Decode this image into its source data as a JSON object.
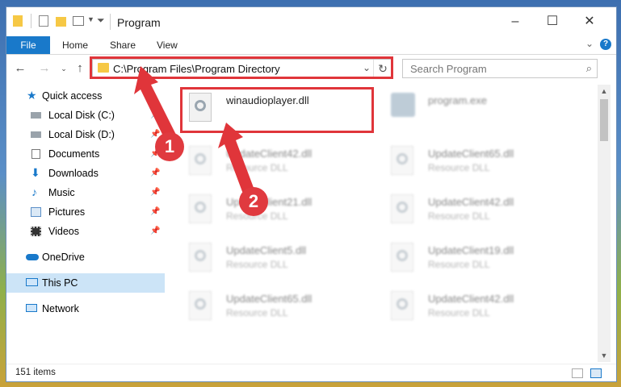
{
  "window": {
    "title": "Program"
  },
  "ribbon": {
    "file_tab": "File",
    "home_tab": "Home",
    "share_tab": "Share",
    "view_tab": "View"
  },
  "address": {
    "path": "C:\\Program Files\\Program Directory"
  },
  "search": {
    "placeholder": "Search Program"
  },
  "sidebar": {
    "items": [
      {
        "label": "Quick access"
      },
      {
        "label": "Local Disk (C:)"
      },
      {
        "label": "Local Disk (D:)"
      },
      {
        "label": "Documents"
      },
      {
        "label": "Downloads"
      },
      {
        "label": "Music"
      },
      {
        "label": "Pictures"
      },
      {
        "label": "Videos"
      },
      {
        "label": "OneDrive"
      },
      {
        "label": "This PC"
      },
      {
        "label": "Network"
      }
    ]
  },
  "files": [
    {
      "name": "winaudioplayer.dll",
      "type": ""
    },
    {
      "name": "program.exe",
      "type": ""
    },
    {
      "name": "UpdateClient42.dll",
      "type": "Resource DLL"
    },
    {
      "name": "UpdateClient65.dll",
      "type": "Resource DLL"
    },
    {
      "name": "UpdateClient21.dll",
      "type": "Resource DLL"
    },
    {
      "name": "UpdateClient42.dll",
      "type": "Resource DLL"
    },
    {
      "name": "UpdateClient5.dll",
      "type": "Resource DLL"
    },
    {
      "name": "UpdateClient19.dll",
      "type": "Resource DLL"
    },
    {
      "name": "UpdateClient65.dll",
      "type": "Resource DLL"
    },
    {
      "name": "UpdateClient42.dll",
      "type": "Resource DLL"
    }
  ],
  "status": {
    "count": "151 items"
  },
  "annotations": {
    "step1": "1",
    "step2": "2",
    "color": "#e0353a"
  }
}
